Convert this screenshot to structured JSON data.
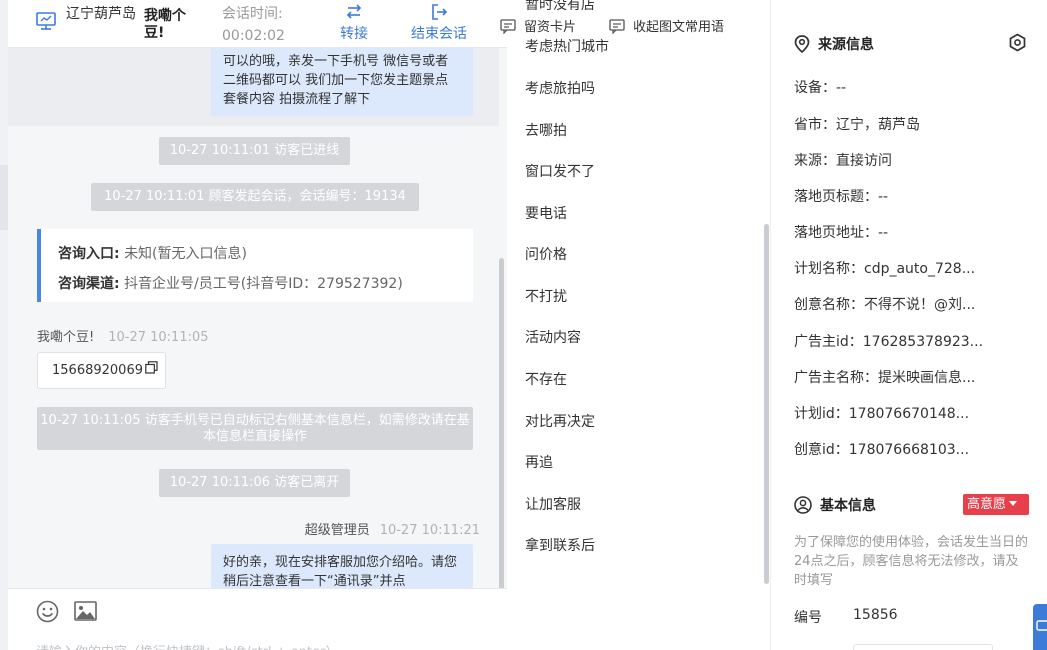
{
  "header": {
    "location": "辽宁葫芦岛",
    "visitor_name": "我嘞个豆!",
    "time_label": "会话时间:",
    "duration": "00:02:02",
    "transfer_label": "转接",
    "end_label": "结束会话"
  },
  "messages": {
    "agent_bubble_1": "可以的哦，亲发一下手机号 微信号或者二维码都可以 我们加一下您发主题景点 套餐内容 拍摄流程了解下",
    "sys_1": "10-27 10:11:01 访客已进线",
    "sys_2": "10-27 10:11:01 顾客发起会话，会话编号：19134",
    "entry_label": "咨询入口:",
    "entry_value": "未知(暂无入口信息)",
    "channel_label": "咨询渠道:",
    "channel_value": "抖音企业号/员工号(抖音号ID：279527392)",
    "visitor_sender": "我嘞个豆!",
    "visitor_time": "10-27 10:11:05",
    "visitor_phone": "15668920069",
    "sys_3": "10-27 10:11:05 访客手机号已自动标记右侧基本信息栏，如需修改请在基本信息栏直接操作",
    "sys_4": "10-27 10:11:06 访客已离开",
    "agent_sender": "超级管理员",
    "agent_time": "10-27 10:11:21",
    "agent_bubble_2": "好的亲，现在安排客服加您介绍哈。请您稍后注意查看一下“通讯录”并点"
  },
  "footer": {
    "card_label": "留资卡片",
    "phrases_label": "收起图文常用语",
    "composer_placeholder": "请输入你的内容（换行快捷键：shift/ctrl + enter）"
  },
  "phrases": [
    "暂时没有店",
    "考虑热门城市",
    "考虑旅拍吗",
    "去哪拍",
    "窗口发不了",
    "要电话",
    "问价格",
    "不打扰",
    "活动内容",
    "不存在",
    "对比再决定",
    "再追",
    "让加客服",
    "拿到联系后"
  ],
  "source": {
    "title": "来源信息",
    "rows": [
      "设备：--",
      "省市：辽宁，葫芦岛",
      "来源：直接访问",
      "落地页标题：--",
      "落地页地址：--",
      "计划名称：cdp_auto_728...",
      "创意名称：不得不说！@刘...",
      "广告主id：176285378923...",
      "广告主名称：提米映画信息...",
      "计划id：178076670148...",
      "创意id：178076668103..."
    ]
  },
  "basic": {
    "title": "基本信息",
    "intent_tag": "高意愿",
    "notice": "为了保障您的使用体验，会话发生当日的24点之后，顾客信息将无法修改，请及时填写",
    "id_label": "编号",
    "id_value": "15856"
  },
  "colors": {
    "accent": "#3d7bd9",
    "tag_red": "#e8404b",
    "bubble_blue": "#dce8fb"
  }
}
